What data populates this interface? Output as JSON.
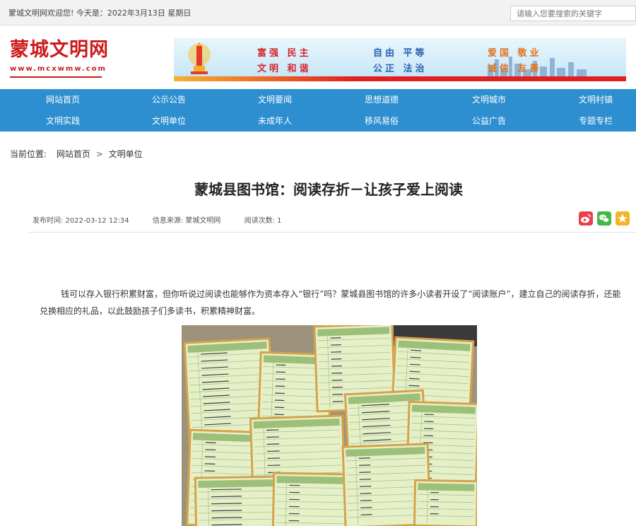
{
  "topbar": {
    "welcome": "蒙城文明网欢迎您! 今天是：2022年3月13日 星期日",
    "search_placeholder": "请输入您要搜索的关键字"
  },
  "header": {
    "logo": "蒙城文明网",
    "logo_url": "www.mcxwmw.com",
    "values": {
      "col1_row1": "富强 民主",
      "col1_row2": "文明 和谐",
      "col2_row1": "自由 平等",
      "col2_row2": "公正 法治",
      "col3_row1": "爱国 敬业",
      "col3_row2": "诚信 友善"
    }
  },
  "nav": {
    "row1": [
      "网站首页",
      "公示公告",
      "文明要闻",
      "思想道德",
      "文明城市",
      "文明村镇"
    ],
    "row2": [
      "文明实践",
      "文明单位",
      "未成年人",
      "移风易俗",
      "公益广告",
      "专题专栏"
    ]
  },
  "breadcrumb": {
    "label": "当前位置:",
    "items": [
      "网站首页",
      "文明单位"
    ],
    "separator": ">"
  },
  "article": {
    "title": "蒙城县图书馆：阅读存折－让孩子爱上阅读",
    "meta": {
      "time": "发布时间: 2022-03-12 12:34",
      "source": "信息来源: 蒙城文明网",
      "views": "阅读次数: 1"
    },
    "paragraph": "钱可以存入银行积累财富，但你听说过阅读也能够作为资本存入“银行”吗？蒙城县图书馆的许多小读者开设了“阅读账户”，建立自己的阅读存折，还能兑换相应的礼品，以此鼓励孩子们多读书，积累精神财富。"
  },
  "share": {
    "icons": [
      "weibo-icon",
      "wechat-icon",
      "star-icon"
    ]
  },
  "colors": {
    "brand_red": "#cc1a1a",
    "nav_blue": "#2d8fcf",
    "weibo": "#e8404b",
    "wechat": "#42b849",
    "favorite": "#f0b626"
  }
}
